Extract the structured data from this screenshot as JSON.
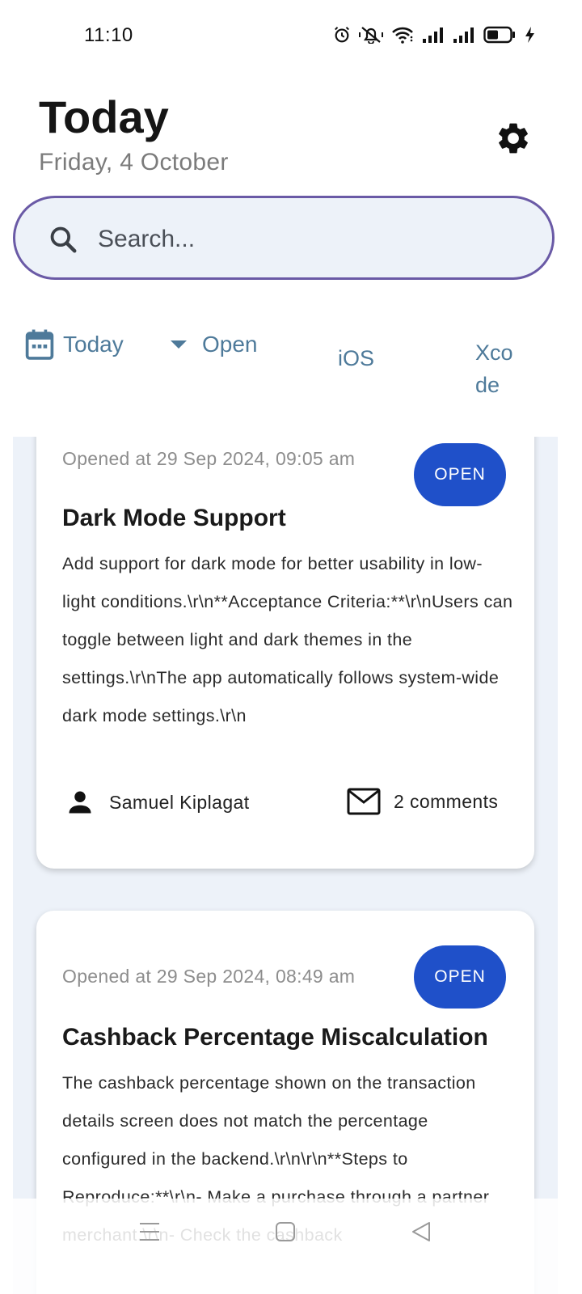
{
  "status_bar": {
    "time": "11:10",
    "icons": [
      "alarm-icon",
      "mute-icon",
      "wifi-icon",
      "signal-icon",
      "signal-icon",
      "battery-icon",
      "charging-icon"
    ]
  },
  "header": {
    "title": "Today",
    "date": "Friday, 4 October",
    "settings_icon": "gear-icon"
  },
  "search": {
    "placeholder": "Search...",
    "value": ""
  },
  "filters": {
    "date": {
      "label": "Today",
      "icon": "calendar-icon"
    },
    "status": {
      "label": "Open",
      "icon": "dropdown-arrow-icon"
    },
    "platform": {
      "label": "iOS"
    },
    "tool": {
      "label": "Xcode"
    }
  },
  "issues": [
    {
      "opened": "Opened at 29 Sep 2024, 09:05 am",
      "status": "OPEN",
      "title": "Dark Mode Support",
      "description": "Add support for dark mode for better usability in low-light conditions.\\r\\n**Acceptance Criteria:**\\r\\nUsers can toggle between light and dark themes in the settings.\\r\\nThe app automatically follows system-wide dark mode settings.\\r\\n",
      "author": "Samuel Kiplagat",
      "comments": "2 comments"
    },
    {
      "opened": "Opened at 29 Sep 2024, 08:49 am",
      "status": "OPEN",
      "title": "Cashback Percentage Miscalculation",
      "description": "The cashback percentage shown on the transaction details screen does not match the percentage configured in the backend.\\r\\n\\r\\n**Steps to Reproduce:**\\r\\n- Make a purchase through a partner merchant.\\r\\n- Check the cashback"
    }
  ],
  "colors": {
    "accent": "#1f50c9",
    "filter_text": "#4e7a9a",
    "search_border": "#6a5aa6",
    "list_background": "#edf2f9"
  },
  "navigation": {
    "icons": [
      "menu-icon",
      "home-icon",
      "back-icon"
    ]
  }
}
